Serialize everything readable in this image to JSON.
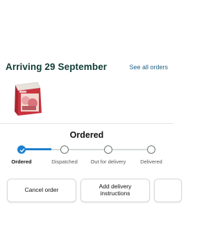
{
  "header": {
    "arrival_title": "Arriving 29 September",
    "see_all_label": "See all orders"
  },
  "status": {
    "title": "Ordered",
    "steps": [
      {
        "label": "Ordered",
        "state": "current"
      },
      {
        "label": "Dispatched",
        "state": "pending"
      },
      {
        "label": "Out for delivery",
        "state": "pending"
      },
      {
        "label": "Delivered",
        "state": "pending"
      }
    ],
    "progress": 0.25
  },
  "actions": {
    "cancel_label": "Cancel order",
    "delivery_label": "Add delivery instructions"
  },
  "colors": {
    "accent": "#1c7fd0",
    "title": "#0f3b33",
    "link": "#1f5f84"
  }
}
